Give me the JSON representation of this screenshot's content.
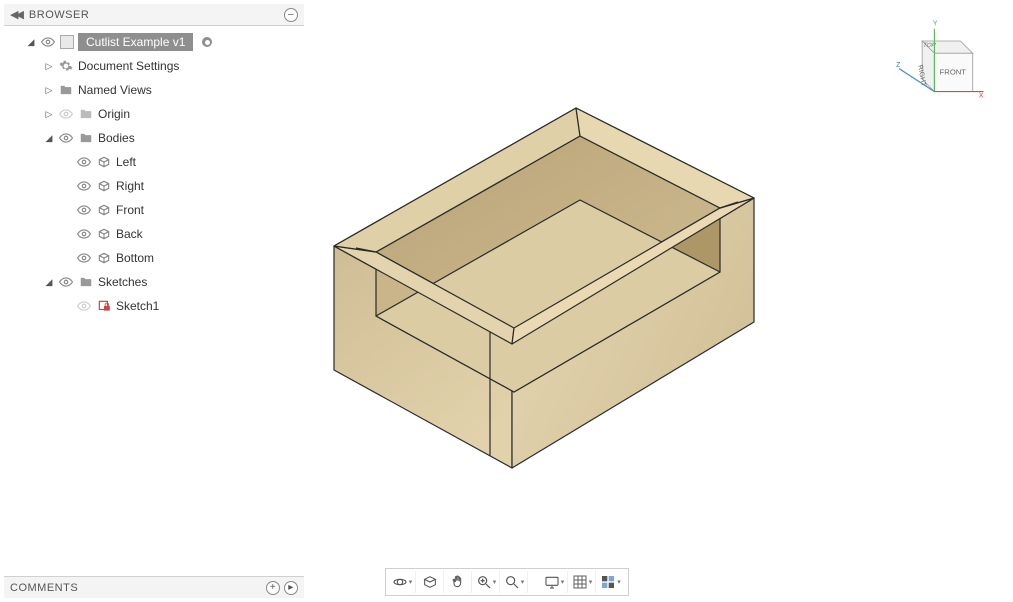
{
  "browser": {
    "title": "BROWSER",
    "root": {
      "label": "Cutlist Example v1"
    },
    "items": {
      "doc_settings": "Document Settings",
      "named_views": "Named Views",
      "origin": "Origin",
      "bodies": "Bodies",
      "body_left": "Left",
      "body_right": "Right",
      "body_front": "Front",
      "body_back": "Back",
      "body_bottom": "Bottom",
      "sketches": "Sketches",
      "sketch1": "Sketch1"
    }
  },
  "comments": {
    "title": "COMMENTS"
  },
  "viewcube": {
    "front": "FRONT",
    "right": "RIGHT",
    "top": "TOP",
    "x": "X",
    "y": "Y",
    "z": "Z"
  },
  "toolbar": {
    "orbit": "Orbit",
    "lookat": "Look At",
    "pan": "Pan",
    "zoom": "Zoom",
    "fit": "Fit",
    "display": "Display Settings",
    "grid": "Grid",
    "viewports": "Viewports"
  }
}
